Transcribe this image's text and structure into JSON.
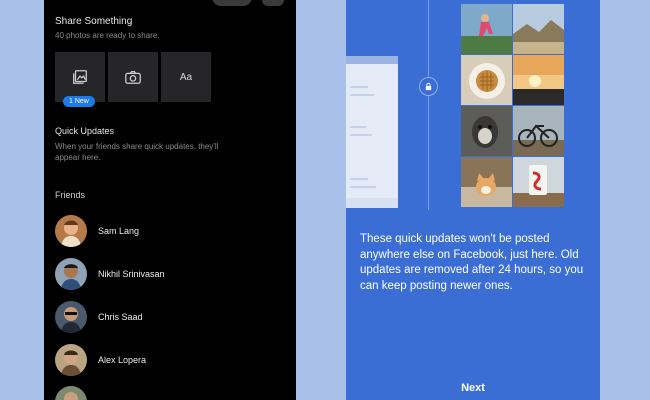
{
  "left": {
    "share": {
      "title": "Share Something",
      "subtitle": "40 photos are ready to share.",
      "text_tile_label": "Aa",
      "badge": "1 New"
    },
    "quick_updates": {
      "title": "Quick Updates",
      "subtitle": "When your friends share quick updates, they'll appear here."
    },
    "friends": {
      "title": "Friends",
      "items": [
        {
          "name": "Sam Lang"
        },
        {
          "name": "Nikhil Srinivasan"
        },
        {
          "name": "Chris Saad"
        },
        {
          "name": "Alex Lopera"
        },
        {
          "name": ""
        }
      ]
    }
  },
  "right": {
    "blurb": "These quick updates won't be posted anywhere else on Facebook, just here. Old updates are removed after 24 hours, so you can keep posting newer ones.",
    "next_label": "Next",
    "photos": [
      "runner",
      "landscape",
      "waffle",
      "sunset",
      "dog",
      "bicycle",
      "cat",
      "cup"
    ]
  },
  "colors": {
    "background": "#a8c0ea",
    "dark_panel": "#000000",
    "blue_panel": "#3b6ed4",
    "badge": "#1e7ae8"
  },
  "icons": [
    "photos-icon",
    "camera-icon",
    "lock-icon"
  ]
}
